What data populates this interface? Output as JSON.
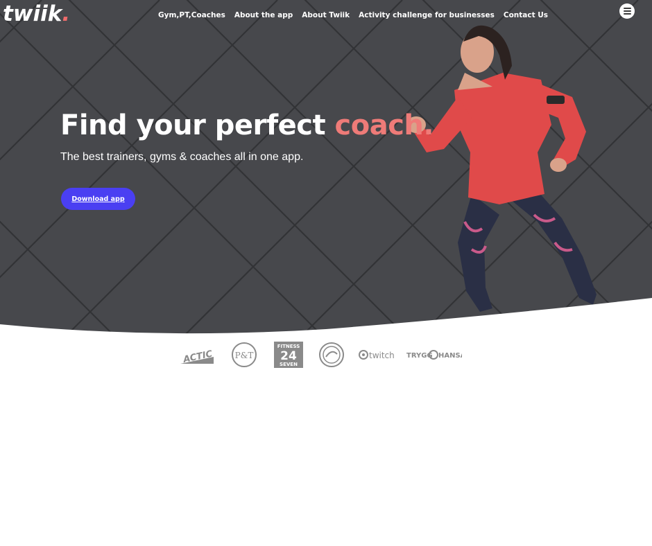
{
  "brand": {
    "logo_text": "twiik",
    "logo_dot": "."
  },
  "nav": {
    "items": [
      {
        "label": "Gym,PT,Coaches"
      },
      {
        "label": "About the app"
      },
      {
        "label": "About Twiik"
      },
      {
        "label": "Activity challenge for businesses"
      },
      {
        "label": "Contact Us"
      }
    ]
  },
  "hero": {
    "headline_main": "Find your perfect ",
    "headline_accent": "coach.",
    "subheadline": "The best trainers, gyms & coaches all in one app.",
    "cta_label": "Download app"
  },
  "partners": {
    "logos": [
      {
        "name": "actic-logo",
        "text": "ACTIC"
      },
      {
        "name": "pt-logo",
        "text": "P&T"
      },
      {
        "name": "fitness24seven-logo",
        "text": "FITNESS 24 SEVEN"
      },
      {
        "name": "round-seal-logo",
        "text": ""
      },
      {
        "name": "twitch-logo",
        "text": "twitch"
      },
      {
        "name": "trygg-hansa-logo",
        "text": "TRYGG HANSA"
      }
    ]
  },
  "colors": {
    "accent": "#ef7b78",
    "cta": "#4a3ff2",
    "hero_bg": "#4a4b4f"
  }
}
